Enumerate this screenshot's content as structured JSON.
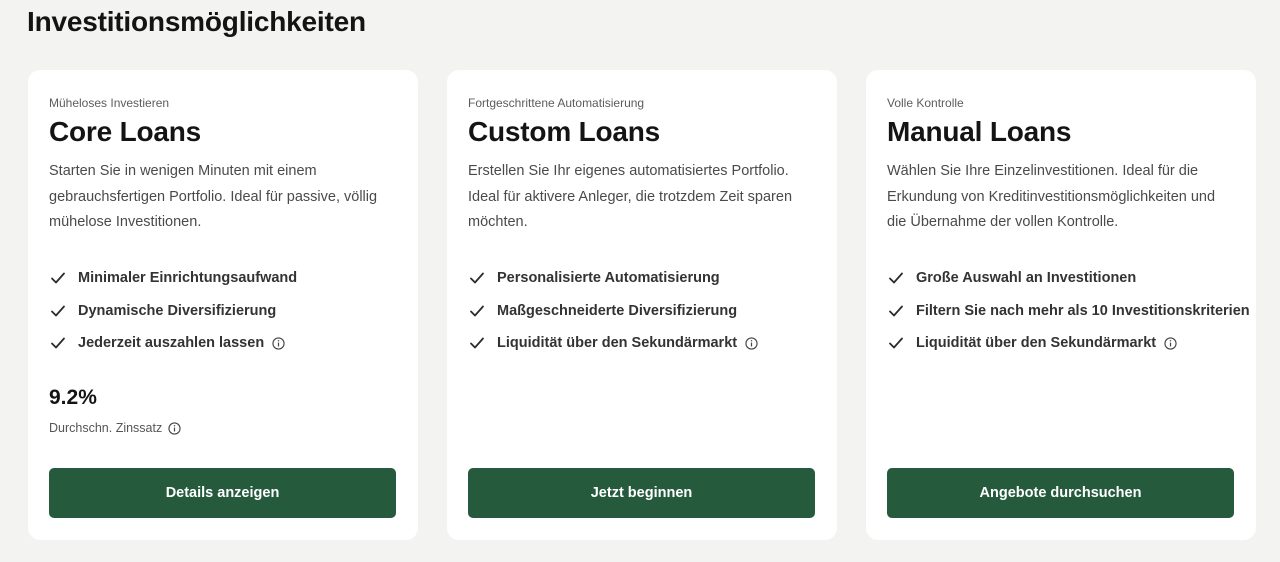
{
  "page": {
    "title": "Investitionsmöglichkeiten"
  },
  "colors": {
    "accent": "#265a3d",
    "background": "#f3f3f1",
    "card": "#ffffff"
  },
  "cards": [
    {
      "eyebrow": "Müheloses Investieren",
      "title": "Core Loans",
      "description": "Starten Sie in wenigen Minuten mit einem gebrauchsfertigen Portfolio. Ideal für passive, völlig mühelose Investitionen.",
      "features": [
        {
          "label": "Minimaler Einrichtungsaufwand",
          "info": false
        },
        {
          "label": "Dynamische Diversifizierung",
          "info": false
        },
        {
          "label": "Jederzeit auszahlen lassen",
          "info": true
        }
      ],
      "rate": "9.2%",
      "rate_label": "Durchschn. Zinssatz",
      "button": "Details anzeigen"
    },
    {
      "eyebrow": "Fortgeschrittene Automatisierung",
      "title": "Custom Loans",
      "description": "Erstellen Sie Ihr eigenes automatisiertes Portfolio. Ideal für aktivere Anleger, die trotzdem Zeit sparen möchten.",
      "features": [
        {
          "label": "Personalisierte Automatisierung",
          "info": false
        },
        {
          "label": "Maßgeschneiderte Diversifizierung",
          "info": false
        },
        {
          "label": "Liquidität über den Sekundärmarkt",
          "info": true
        }
      ],
      "button": "Jetzt beginnen"
    },
    {
      "eyebrow": "Volle Kontrolle",
      "title": "Manual Loans",
      "description": "Wählen Sie Ihre Einzelinvestitionen. Ideal für die Erkundung von Kreditinvestitionsmöglichkeiten und die Übernahme der vollen Kontrolle.",
      "features": [
        {
          "label": "Große Auswahl an Investitionen",
          "info": false
        },
        {
          "label": "Filtern Sie nach mehr als 10 Investitionskriterien",
          "info": false
        },
        {
          "label": "Liquidität über den Sekundärmarkt",
          "info": true
        }
      ],
      "button": "Angebote durchsuchen"
    }
  ]
}
